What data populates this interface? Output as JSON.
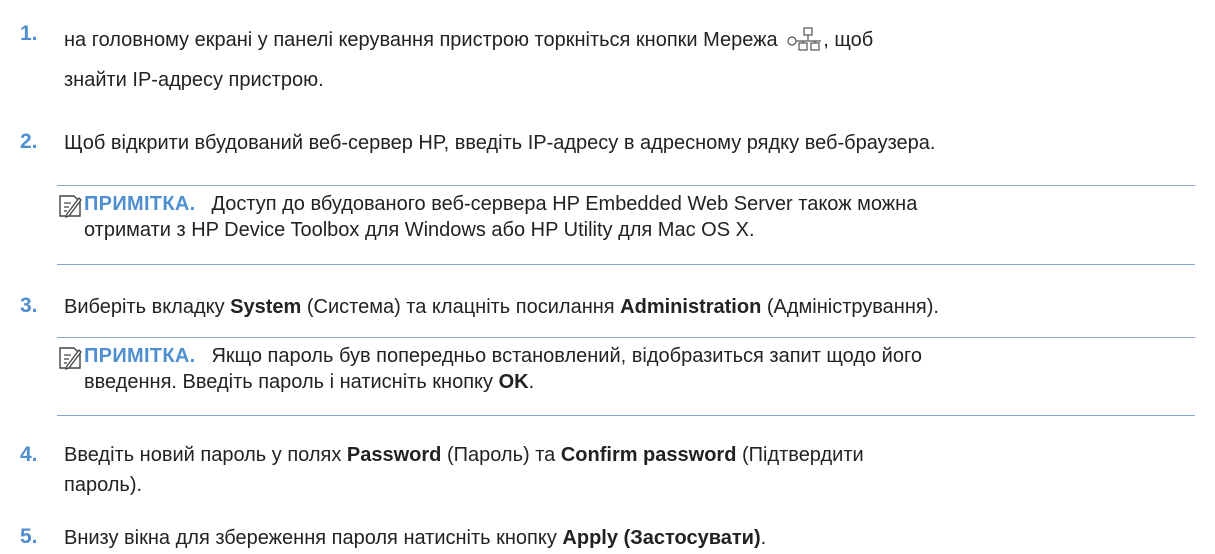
{
  "steps": [
    {
      "num": "1.",
      "text_a": "на головному екрані у панелі керування пристрою торкніться кнопки Мережа ",
      "text_b": ", щоб",
      "text_c": "знайти IP-адресу пристрою."
    },
    {
      "num": "2.",
      "text": "Щоб відкрити вбудований веб-сервер HP, введіть IP-адресу в адресному рядку веб-браузера."
    },
    {
      "num": "3.",
      "a": "Виберіть вкладку ",
      "b1": "System",
      "c": " (Система) та клацніть посилання ",
      "b2": "Administration",
      "d": " (Адміністрування)."
    },
    {
      "num": "4.",
      "a": "Введіть новий пароль у полях ",
      "b1": "Password",
      "c": " (Пароль) та ",
      "b2": "Confirm password",
      "d": " (Підтвердити",
      "e": "пароль)."
    },
    {
      "num": "5.",
      "a": "Внизу вікна для збереження пароля натисніть кнопку ",
      "b1": "Apply (Застосувати)",
      "d": "."
    }
  ],
  "notes": [
    {
      "label": "ПРИМІТКА.",
      "line1": "Доступ до вбудованого веб-сервера HP Embedded Web Server також можна",
      "line2": "отримати з HP Device Toolbox для Windows або HP Utility для Mac OS X."
    },
    {
      "label": "ПРИМІТКА.",
      "line1": "Якщо пароль був попередньо встановлений, відобразиться запит щодо його",
      "line2a": "введення. Введіть пароль і натисніть кнопку ",
      "line2b": "OK",
      "line2c": "."
    }
  ],
  "colors": {
    "accent": "#4f8fcf",
    "rule": "#7fa9d3",
    "text": "#222222"
  },
  "icons": [
    "network-icon",
    "note-icon"
  ]
}
